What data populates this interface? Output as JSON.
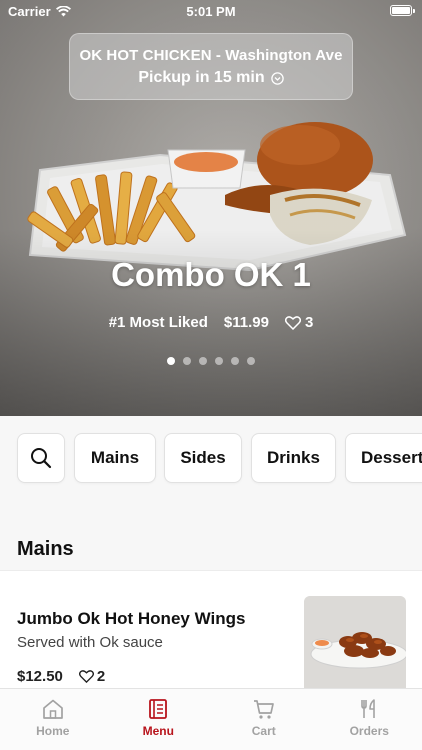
{
  "status_bar": {
    "carrier": "Carrier",
    "time": "5:01 PM"
  },
  "store": {
    "name": "OK HOT CHICKEN - Washington Ave",
    "pickup": "Pickup in 15 min"
  },
  "hero": {
    "title": "Combo OK 1",
    "badge": "#1 Most Liked",
    "price": "$11.99",
    "likes": "3",
    "carousel_count": 6,
    "carousel_active": 0
  },
  "categories": [
    "Mains",
    "Sides",
    "Drinks",
    "Dessert"
  ],
  "section": {
    "title": "Mains"
  },
  "items": [
    {
      "name": "Jumbo Ok Hot Honey Wings",
      "description": "Served with Ok sauce",
      "price": "$12.50",
      "likes": "2"
    }
  ],
  "tabs": [
    {
      "label": "Home",
      "icon": "home-icon",
      "active": false
    },
    {
      "label": "Menu",
      "icon": "menu-book-icon",
      "active": true
    },
    {
      "label": "Cart",
      "icon": "cart-icon",
      "active": false
    },
    {
      "label": "Orders",
      "icon": "fork-knife-icon",
      "active": false
    }
  ],
  "colors": {
    "accent": "#b8141c",
    "inactive_tab": "#a2a2a2"
  }
}
